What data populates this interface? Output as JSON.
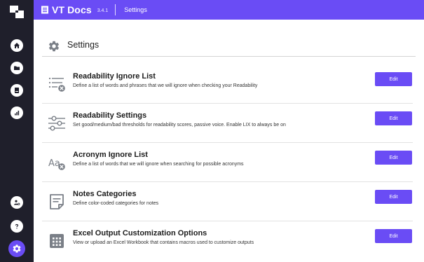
{
  "app": {
    "name": "VT Docs",
    "version": "3.4.1",
    "breadcrumb": "Settings"
  },
  "page": {
    "title": "Settings"
  },
  "settings": [
    {
      "title": "Readability Ignore List",
      "description": "Define a list of words and phrases that we will ignore when checking your Readability",
      "button": "Edit",
      "icon": "list-remove-icon"
    },
    {
      "title": "Readability Settings",
      "description": "Set good/medium/bad thresholds for readability scores, passive voice. Enable LIX to always be on",
      "button": "Edit",
      "icon": "sliders-icon"
    },
    {
      "title": "Acronym Ignore List",
      "description": "Define a list of words that we will ignore when searching for possible acronyms",
      "button": "Edit",
      "icon": "acronym-remove-icon"
    },
    {
      "title": "Notes Categories",
      "description": "Define color-coded categories for notes",
      "button": "Edit",
      "icon": "note-icon"
    },
    {
      "title": "Excel Output Customization Options",
      "description": "View or upload an Excel Workbook that contains macros used to customize outputs",
      "button": "Edit",
      "icon": "grid-icon"
    }
  ],
  "sidebar": {
    "icons": [
      "home-icon",
      "folder-icon",
      "document-icon",
      "analytics-icon",
      "users-settings-icon",
      "help-icon",
      "settings-icon"
    ],
    "active": "settings-icon"
  },
  "colors": {
    "accent": "#6a4cf5",
    "sidebar": "#1f1f2b",
    "icon_gray": "#7a7f87"
  }
}
